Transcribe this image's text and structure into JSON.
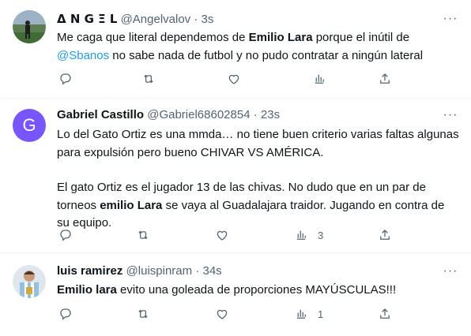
{
  "tweets": [
    {
      "name": "Δ N G Ξ L",
      "handle": "@Angelvalov",
      "time": "3s",
      "text": {
        "p1_a": "Me caga que literal dependemos de ",
        "p1_b": "Emilio Lara",
        "p1_c": " porque el inútil de",
        "mention": "@Sbanos",
        "p1_d": " no sabe nada de futbol y no pudo contratar a ningún lateral"
      },
      "views": ""
    },
    {
      "name": "Gabriel Castillo",
      "handle": "@Gabriel68602854",
      "time": "23s",
      "avatar_letter": "G",
      "text": {
        "p1": "Lo del Gato Ortiz es una mmda… no tiene buen criterio varias faltas algunas para expulsión pero bueno CHIVAR VS AMÉRICA.",
        "p2_a": "El gato Ortiz es el jugador 13 de las chivas. No dudo que en un par de torneos ",
        "p2_b": "emilio Lara",
        "p2_c": " se vaya al Guadalajara traidor. Jugando en contra de su equipo."
      },
      "views": "3"
    },
    {
      "name": "luis ramirez",
      "handle": "@luispinram",
      "time": "34s",
      "text": {
        "p1_a": "Emilio lara",
        "p1_b": " evito una goleada de proporciones MAYÚSCULAS!!!"
      },
      "views": "1"
    }
  ],
  "separator": "·",
  "more_label": "···",
  "colors": {
    "text": "#0f1419",
    "secondary": "#536471",
    "link": "#1d9bf0",
    "avatar_g": "#7856ff",
    "divider": "#eff3f4"
  },
  "icons": [
    "reply-icon",
    "retweet-icon",
    "like-icon",
    "views-icon",
    "share-icon",
    "more-icon"
  ]
}
